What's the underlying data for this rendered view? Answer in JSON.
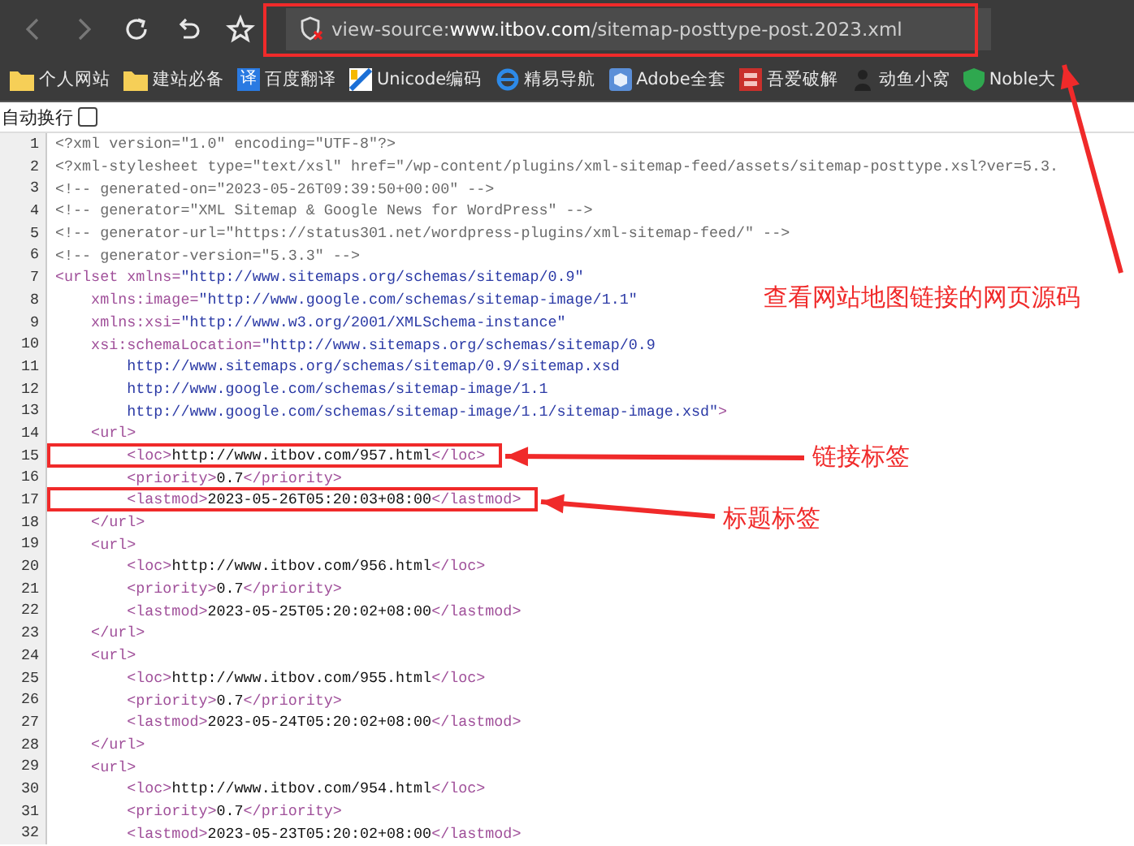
{
  "toolbar": {
    "buttons": [
      {
        "kind": "back",
        "disabled": true
      },
      {
        "kind": "forward",
        "disabled": true
      },
      {
        "kind": "reload",
        "disabled": false
      },
      {
        "kind": "undo",
        "disabled": false
      },
      {
        "kind": "star",
        "disabled": false
      }
    ],
    "address": [
      {
        "kind": "scheme",
        "text": "view-source:"
      },
      {
        "kind": "host",
        "text": "www.itbov.com"
      },
      {
        "kind": "path",
        "text": "/sitemap-posttype-post.2023.xml"
      }
    ]
  },
  "bookmarks": [
    {
      "kind": "folder",
      "label": "个人网站"
    },
    {
      "kind": "folder",
      "label": "建站必备"
    },
    {
      "kind": "glyph",
      "glyph": "译",
      "label": "百度翻译"
    },
    {
      "kind": "unicode",
      "label": "Unicode编码"
    },
    {
      "kind": "e",
      "label": "精易导航"
    },
    {
      "kind": "cube",
      "label": "Adobe全套"
    },
    {
      "kind": "stamp",
      "label": "吾爱破解"
    },
    {
      "kind": "figure",
      "label": "动鱼小窝"
    },
    {
      "kind": "shield",
      "label": "Noble大"
    }
  ],
  "wrap_option": {
    "label": "自动换行",
    "checked": false
  },
  "source_lines": [
    {
      "number": "1",
      "tokens": [
        {
          "kind": "pi",
          "text": "<?xml version=\"1.0\" encoding=\"UTF-8\"?>"
        }
      ]
    },
    {
      "number": "2",
      "tokens": [
        {
          "kind": "pi",
          "text": "<?xml-stylesheet type=\"text/xsl\" href=\"/wp-content/plugins/xml-sitemap-feed/assets/sitemap-posttype.xsl?ver=5.3."
        }
      ]
    },
    {
      "number": "3",
      "tokens": [
        {
          "kind": "comment",
          "text": "<!-- generated-on=\"2023-05-26T09:39:50+00:00\" -->"
        }
      ]
    },
    {
      "number": "4",
      "tokens": [
        {
          "kind": "comment",
          "text": "<!-- generator=\"XML Sitemap & Google News for WordPress\" -->"
        }
      ]
    },
    {
      "number": "5",
      "tokens": [
        {
          "kind": "comment",
          "text": "<!-- generator-url=\"https://status301.net/wordpress-plugins/xml-sitemap-feed/\" -->"
        }
      ]
    },
    {
      "number": "6",
      "tokens": [
        {
          "kind": "comment",
          "text": "<!-- generator-version=\"5.3.3\" -->"
        }
      ]
    },
    {
      "number": "7",
      "tokens": [
        {
          "kind": "tag",
          "text": "<urlset"
        },
        {
          "kind": "attr",
          "text": " xmlns="
        },
        {
          "kind": "val",
          "text": "\"http://www.sitemaps.org/schemas/sitemap/0.9\""
        }
      ]
    },
    {
      "number": "8",
      "tokens": [
        {
          "kind": "attr",
          "text": "    xmlns:image="
        },
        {
          "kind": "val",
          "text": "\"http://www.google.com/schemas/sitemap-image/1.1\""
        }
      ]
    },
    {
      "number": "9",
      "tokens": [
        {
          "kind": "attr",
          "text": "    xmlns:xsi="
        },
        {
          "kind": "val",
          "text": "\"http://www.w3.org/2001/XMLSchema-instance\""
        }
      ]
    },
    {
      "number": "10",
      "tokens": [
        {
          "kind": "attr",
          "text": "    xsi:schemaLocation="
        },
        {
          "kind": "val",
          "text": "\"http://www.sitemaps.org/schemas/sitemap/0.9"
        }
      ]
    },
    {
      "number": "11",
      "tokens": [
        {
          "kind": "val",
          "text": "        http://www.sitemaps.org/schemas/sitemap/0.9/sitemap.xsd"
        }
      ]
    },
    {
      "number": "12",
      "tokens": [
        {
          "kind": "val",
          "text": "        http://www.google.com/schemas/sitemap-image/1.1"
        }
      ]
    },
    {
      "number": "13",
      "tokens": [
        {
          "kind": "val",
          "text": "        http://www.google.com/schemas/sitemap-image/1.1/sitemap-image.xsd\""
        },
        {
          "kind": "tag",
          "text": ">"
        }
      ]
    },
    {
      "number": "14",
      "tokens": [
        {
          "kind": "tag",
          "text": "    <url>"
        }
      ]
    },
    {
      "number": "15",
      "tokens": [
        {
          "kind": "tag",
          "text": "        <loc>"
        },
        {
          "kind": "text",
          "text": "http://www.itbov.com/957.html"
        },
        {
          "kind": "tag",
          "text": "</loc>"
        }
      ]
    },
    {
      "number": "16",
      "tokens": [
        {
          "kind": "tag",
          "text": "        <priority>"
        },
        {
          "kind": "text",
          "text": "0.7"
        },
        {
          "kind": "tag",
          "text": "</priority>"
        }
      ]
    },
    {
      "number": "17",
      "tokens": [
        {
          "kind": "tag",
          "text": "        <lastmod>"
        },
        {
          "kind": "text",
          "text": "2023-05-26T05:20:03+08:00"
        },
        {
          "kind": "tag",
          "text": "</lastmod>"
        }
      ]
    },
    {
      "number": "18",
      "tokens": [
        {
          "kind": "tag",
          "text": "    </url>"
        }
      ]
    },
    {
      "number": "19",
      "tokens": [
        {
          "kind": "tag",
          "text": "    <url>"
        }
      ]
    },
    {
      "number": "20",
      "tokens": [
        {
          "kind": "tag",
          "text": "        <loc>"
        },
        {
          "kind": "text",
          "text": "http://www.itbov.com/956.html"
        },
        {
          "kind": "tag",
          "text": "</loc>"
        }
      ]
    },
    {
      "number": "21",
      "tokens": [
        {
          "kind": "tag",
          "text": "        <priority>"
        },
        {
          "kind": "text",
          "text": "0.7"
        },
        {
          "kind": "tag",
          "text": "</priority>"
        }
      ]
    },
    {
      "number": "22",
      "tokens": [
        {
          "kind": "tag",
          "text": "        <lastmod>"
        },
        {
          "kind": "text",
          "text": "2023-05-25T05:20:02+08:00"
        },
        {
          "kind": "tag",
          "text": "</lastmod>"
        }
      ]
    },
    {
      "number": "23",
      "tokens": [
        {
          "kind": "tag",
          "text": "    </url>"
        }
      ]
    },
    {
      "number": "24",
      "tokens": [
        {
          "kind": "tag",
          "text": "    <url>"
        }
      ]
    },
    {
      "number": "25",
      "tokens": [
        {
          "kind": "tag",
          "text": "        <loc>"
        },
        {
          "kind": "text",
          "text": "http://www.itbov.com/955.html"
        },
        {
          "kind": "tag",
          "text": "</loc>"
        }
      ]
    },
    {
      "number": "26",
      "tokens": [
        {
          "kind": "tag",
          "text": "        <priority>"
        },
        {
          "kind": "text",
          "text": "0.7"
        },
        {
          "kind": "tag",
          "text": "</priority>"
        }
      ]
    },
    {
      "number": "27",
      "tokens": [
        {
          "kind": "tag",
          "text": "        <lastmod>"
        },
        {
          "kind": "text",
          "text": "2023-05-24T05:20:02+08:00"
        },
        {
          "kind": "tag",
          "text": "</lastmod>"
        }
      ]
    },
    {
      "number": "28",
      "tokens": [
        {
          "kind": "tag",
          "text": "    </url>"
        }
      ]
    },
    {
      "number": "29",
      "tokens": [
        {
          "kind": "tag",
          "text": "    <url>"
        }
      ]
    },
    {
      "number": "30",
      "tokens": [
        {
          "kind": "tag",
          "text": "        <loc>"
        },
        {
          "kind": "text",
          "text": "http://www.itbov.com/954.html"
        },
        {
          "kind": "tag",
          "text": "</loc>"
        }
      ]
    },
    {
      "number": "31",
      "tokens": [
        {
          "kind": "tag",
          "text": "        <priority>"
        },
        {
          "kind": "text",
          "text": "0.7"
        },
        {
          "kind": "tag",
          "text": "</priority>"
        }
      ]
    },
    {
      "number": "32",
      "tokens": [
        {
          "kind": "tag",
          "text": "        <lastmod>"
        },
        {
          "kind": "text",
          "text": "2023-05-23T05:20:02+08:00"
        },
        {
          "kind": "tag",
          "text": "</lastmod>"
        }
      ]
    }
  ],
  "annotations": [
    {
      "kind": "address",
      "text": "查看网站地图链接的网页源码"
    },
    {
      "kind": "line15",
      "text": "链接标签"
    },
    {
      "kind": "line17",
      "text": "标题标签"
    }
  ]
}
